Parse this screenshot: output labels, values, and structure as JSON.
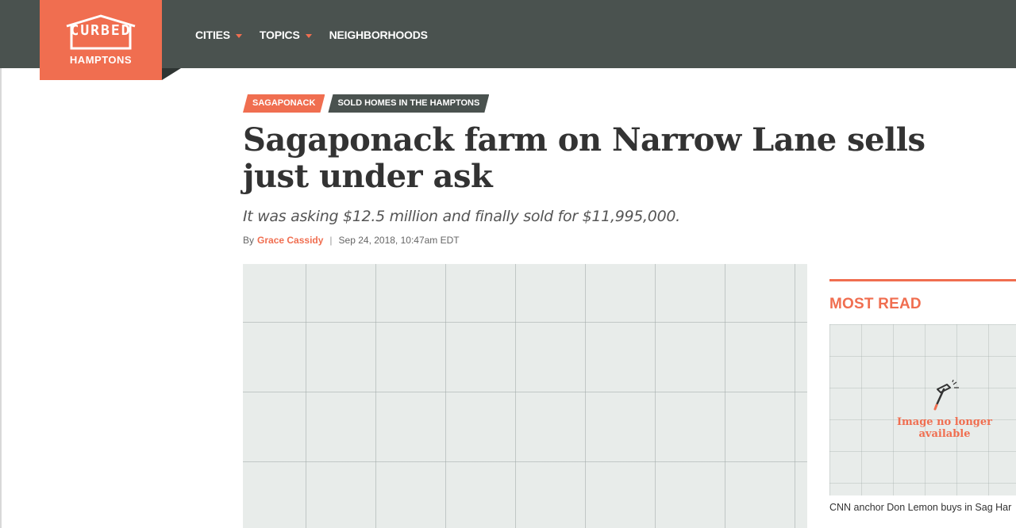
{
  "brand": {
    "wordmark": "CURBED",
    "city": "HAMPTONS",
    "accent_color": "#f06e50",
    "nav_bg_color": "#4a524f"
  },
  "nav": {
    "items": [
      {
        "label": "CITIES",
        "has_dropdown": true
      },
      {
        "label": "TOPICS",
        "has_dropdown": true
      },
      {
        "label": "NEIGHBORHOODS",
        "has_dropdown": false
      }
    ]
  },
  "article": {
    "tags": [
      {
        "label": "SAGAPONACK",
        "style": "red"
      },
      {
        "label": "SOLD HOMES IN THE HAMPTONS",
        "style": "gray"
      }
    ],
    "headline": "Sagaponack farm on Narrow Lane sells just under ask",
    "dek": "It was asking $12.5 million and finally sold for $11,995,000.",
    "byline_prefix": "By",
    "author": "Grace Cassidy",
    "separator": "|",
    "timestamp": "Sep 24, 2018, 10:47am EDT"
  },
  "sidebar": {
    "title": "MOST READ",
    "items": [
      {
        "image_text": "Image no longer available",
        "icon": "hammer-icon",
        "headline": "CNN anchor Don Lemon buys in Sag Har"
      }
    ]
  }
}
